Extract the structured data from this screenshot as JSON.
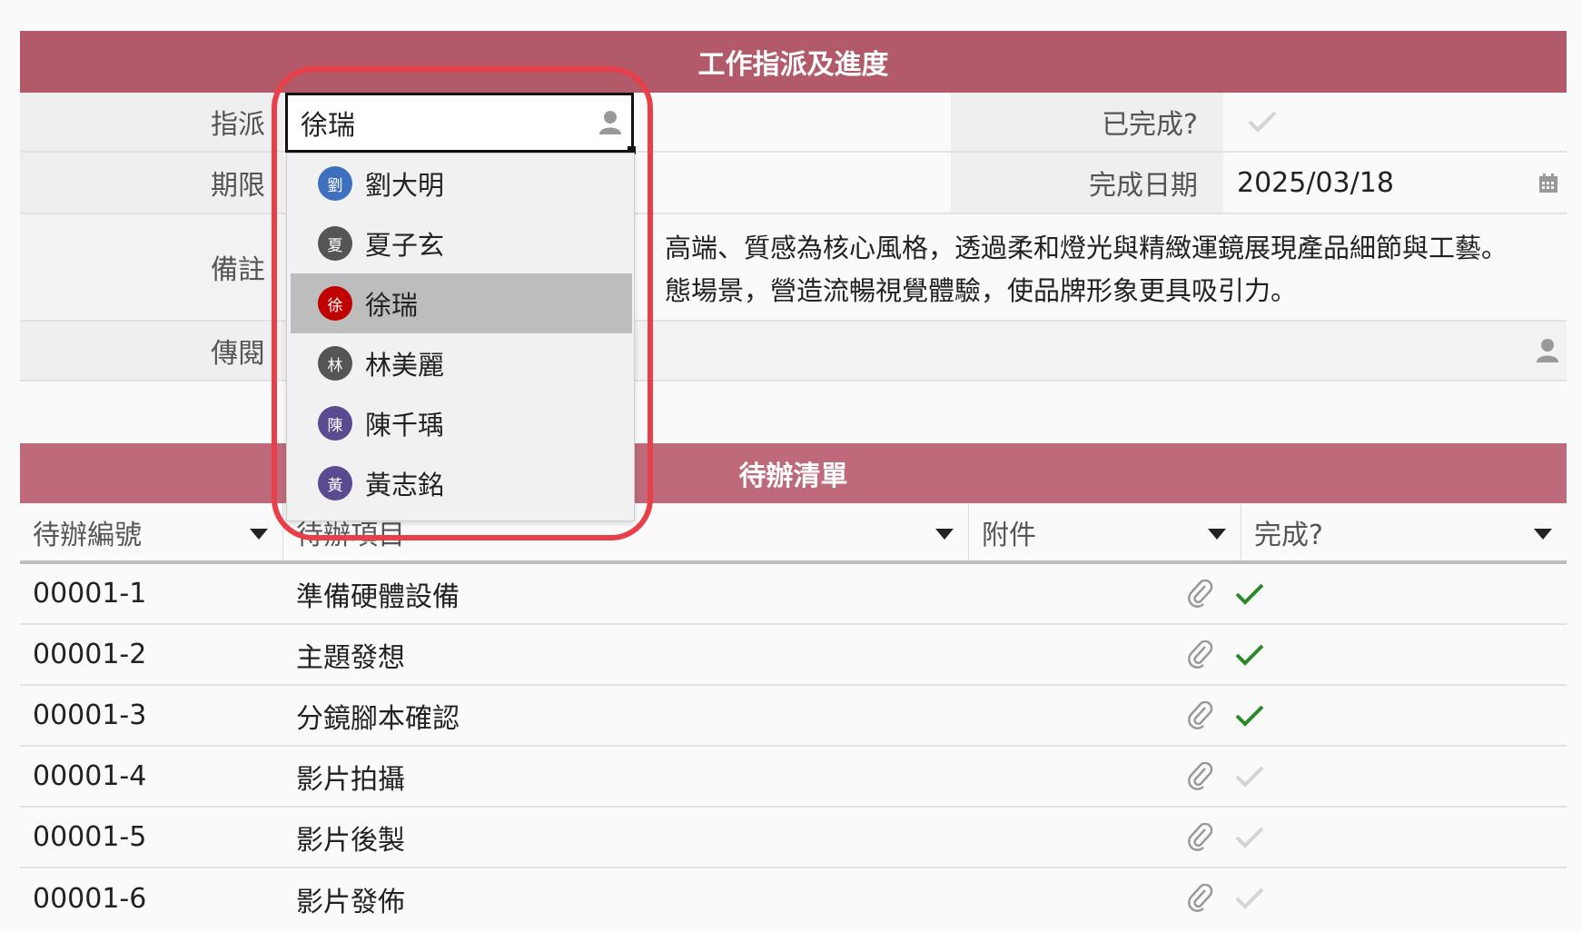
{
  "form": {
    "title": "工作指派及進度",
    "assign_label": "指派",
    "assign_value": "徐瑞",
    "due_label": "期限",
    "note_label": "備註",
    "note_line1": "高端、質感為核心風格，透過柔和燈光與精緻運鏡展現產品細節與工藝。",
    "note_line2": "態場景，營造流暢視覺體驗，使品牌形象更具吸引力。",
    "cc_label": "傳閱",
    "done_label": "已完成?",
    "done_date_label": "完成日期",
    "done_date_value": "2025/03/18"
  },
  "dropdown": {
    "items": [
      {
        "avatar": "劉",
        "name": "劉大明",
        "color": "#3f6fbf"
      },
      {
        "avatar": "夏",
        "name": "夏子玄",
        "color": "#555555"
      },
      {
        "avatar": "徐",
        "name": "徐瑞",
        "color": "#c00000",
        "selected": true
      },
      {
        "avatar": "林",
        "name": "林美麗",
        "color": "#555555"
      },
      {
        "avatar": "陳",
        "name": "陳千瑀",
        "color": "#5b4a8f"
      },
      {
        "avatar": "黃",
        "name": "黃志銘",
        "color": "#5b4a8f"
      }
    ]
  },
  "todo": {
    "title": "待辦清單",
    "columns": [
      "待辦編號",
      "待辦項目",
      "附件",
      "完成?"
    ],
    "rows": [
      {
        "id": "00001-1",
        "item": "準備硬體設備",
        "done": true
      },
      {
        "id": "00001-2",
        "item": "主題發想",
        "done": true
      },
      {
        "id": "00001-3",
        "item": "分鏡腳本確認",
        "done": true
      },
      {
        "id": "00001-4",
        "item": "影片拍攝",
        "done": false
      },
      {
        "id": "00001-5",
        "item": "影片後製",
        "done": false
      },
      {
        "id": "00001-6",
        "item": "影片發佈",
        "done": false
      }
    ]
  },
  "colors": {
    "header_primary": "#b35a6a",
    "header_secondary": "#be6a7a",
    "check_done": "#2a8a2a",
    "check_pending": "#d4d4d4",
    "highlight": "#e8404a"
  }
}
